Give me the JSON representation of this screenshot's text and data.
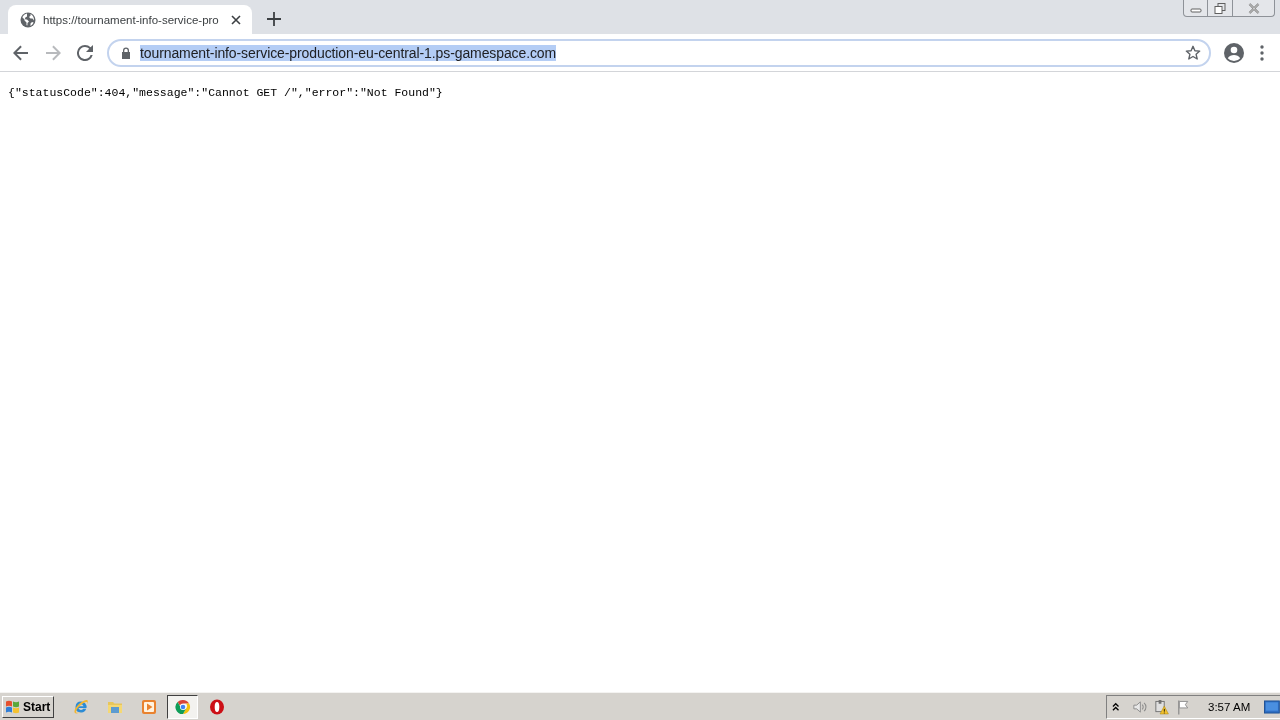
{
  "browser": {
    "tabs": [
      {
        "title": "https://tournament-info-service-pro",
        "selected": true
      }
    ],
    "nav_buttons": [
      {
        "kind": "back",
        "disabled": false
      },
      {
        "kind": "forward",
        "disabled": true
      },
      {
        "kind": "reload",
        "disabled": false
      }
    ],
    "address_bar": {
      "url": "tournament-info-service-production-eu-central-1.ps-gamespace.com",
      "selected": true
    }
  },
  "page": {
    "body_text": "{\"statusCode\":404,\"message\":\"Cannot GET /\",\"error\":\"Not Found\"}"
  },
  "taskbar": {
    "start_label": "Start",
    "apps": [
      {
        "kind": "ie",
        "selected": false
      },
      {
        "kind": "folder",
        "selected": false
      },
      {
        "kind": "media",
        "selected": false
      },
      {
        "kind": "chrome",
        "selected": true
      },
      {
        "kind": "opera",
        "selected": false
      }
    ],
    "clock": "3:57 AM"
  }
}
